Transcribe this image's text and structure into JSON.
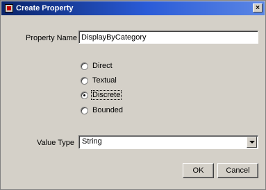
{
  "window": {
    "title": "Create Property",
    "close_symbol": "×"
  },
  "form": {
    "property_name_label": "Property Name",
    "property_name_value": "DisplayByCategory",
    "kind_options": [
      {
        "label": "Direct",
        "checked": false
      },
      {
        "label": "Textual",
        "checked": false
      },
      {
        "label": "Discrete",
        "checked": true
      },
      {
        "label": "Bounded",
        "checked": false
      }
    ],
    "value_type_label": "Value Type",
    "value_type_value": "String"
  },
  "buttons": {
    "ok_label": "OK",
    "cancel_label": "Cancel"
  },
  "icons": {
    "title_icon": "app-icon",
    "close_icon": "close-icon",
    "dropdown_icon": "chevron-down-icon"
  }
}
